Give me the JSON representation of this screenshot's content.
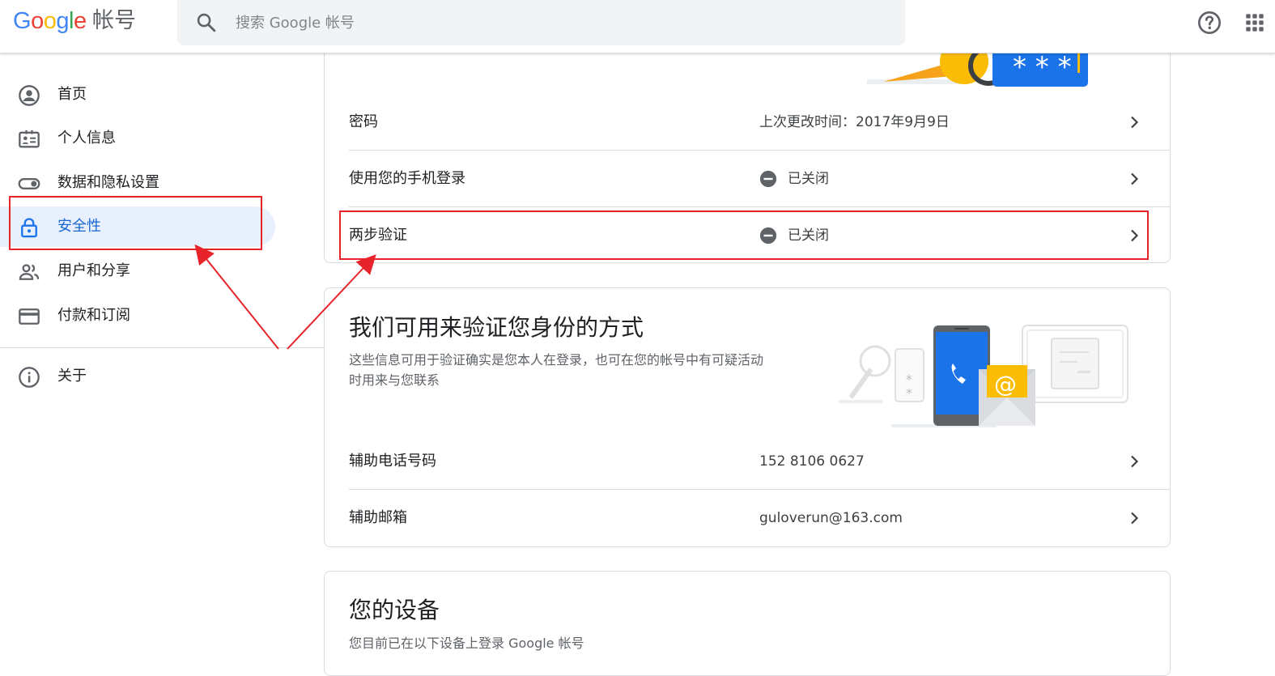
{
  "header": {
    "logo": [
      "G",
      "o",
      "o",
      "g",
      "l",
      "e"
    ],
    "product": "帐号",
    "search_placeholder": "搜索 Google 帐号",
    "icons": [
      "search-icon",
      "help-icon",
      "apps-icon"
    ]
  },
  "sidebar": {
    "items": [
      {
        "label": "首页",
        "icon": "account-circle-icon"
      },
      {
        "label": "个人信息",
        "icon": "id-card-icon"
      },
      {
        "label": "数据和隐私设置",
        "icon": "toggle-icon"
      },
      {
        "label": "安全性",
        "icon": "lock-icon",
        "active": true
      },
      {
        "label": "用户和分享",
        "icon": "people-icon"
      },
      {
        "label": "付款和订阅",
        "icon": "credit-card-icon"
      },
      {
        "label": "关于",
        "icon": "info-icon"
      }
    ]
  },
  "security_card": {
    "rows": [
      {
        "label": "密码",
        "value": "上次更改时间：2017年9月9日"
      },
      {
        "label": "使用您的手机登录",
        "status": "已关闭"
      },
      {
        "label": "两步验证",
        "status": "已关闭"
      }
    ]
  },
  "verify_card": {
    "title": "我们可用来验证您身份的方式",
    "desc_line1": "这些信息可用于验证确实是您本人在登录，也可在您的帐号中有可疑活动",
    "desc_line2": "时用来与您联系",
    "rows": [
      {
        "label": "辅助电话号码",
        "value": "152 8106 0627"
      },
      {
        "label": "辅助邮箱",
        "value": "guloverun@163.com"
      }
    ]
  },
  "devices_card": {
    "title": "您的设备",
    "desc": "您目前已在以下设备上登录 Google 帐号"
  },
  "colors": {
    "accent": "#1a73e8",
    "active_bg": "#e8f0fe",
    "annotation": "#e8242b"
  }
}
